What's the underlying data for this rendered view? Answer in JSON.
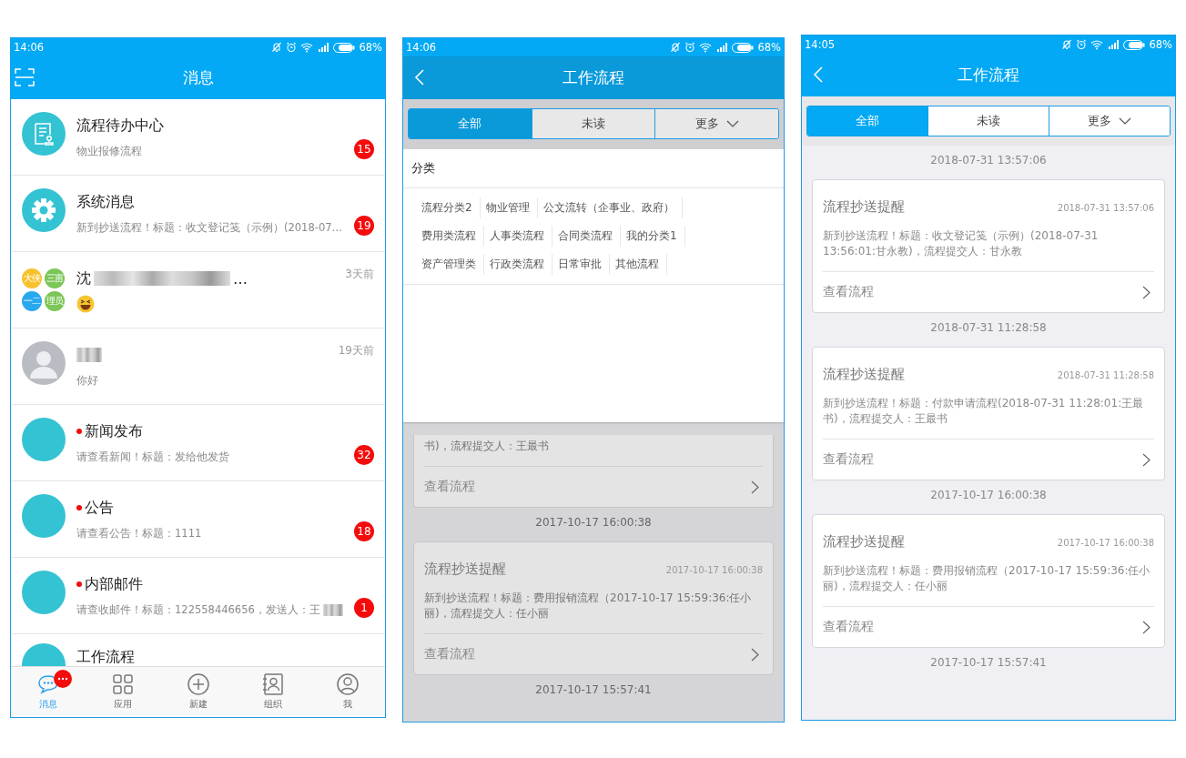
{
  "screens": [
    {
      "kind": "messages",
      "status": {
        "time": "14:06",
        "battery": "68%"
      },
      "title": "消息",
      "conversations": [
        {
          "kind": "document",
          "title": "流程待办中心",
          "subtitle": "物业报修流程",
          "badge": "15",
          "unread_dot": false
        },
        {
          "kind": "gear",
          "title": "系统消息",
          "subtitle": "新到抄送流程！标题：收文登记笺（示例）(2018-07…",
          "badge": "19",
          "unread_dot": false
        },
        {
          "kind": "group",
          "avatar_labels": [
            {
              "text": "大侠",
              "color": "#f8c12e"
            },
            {
              "text": "三亩",
              "color": "#7bc657"
            },
            {
              "text": "一二",
              "color": "#2aa8ee"
            },
            {
              "text": "理员",
              "color": "#7bc657"
            }
          ],
          "title": "沈",
          "title_blurred": true,
          "title_suffix": "…",
          "time": "3天前",
          "subtitle_emoji": true,
          "unread_dot": false
        },
        {
          "kind": "photo",
          "title_blurred": true,
          "time": "19天前",
          "subtitle": "你好",
          "unread_dot": false
        },
        {
          "kind": "plain",
          "title": "新闻发布",
          "subtitle": "请查看新闻！标题：发给他发货",
          "badge": "32",
          "unread_dot": true
        },
        {
          "kind": "plain",
          "title": "公告",
          "subtitle": "请查看公告！标题：1111",
          "badge": "18",
          "unread_dot": true
        },
        {
          "kind": "plain",
          "title": "内部邮件",
          "subtitle": "请查收邮件！标题：122558446656，发送人：王",
          "subtitle_blurred": true,
          "badge": "1",
          "unread_dot": true
        },
        {
          "kind": "plain",
          "title": "工作流程",
          "unread_dot": false,
          "partial": true
        }
      ],
      "tabbar": [
        {
          "kind": "chat",
          "label": "消息",
          "selected": true,
          "more_badge": true
        },
        {
          "kind": "grid",
          "label": "应用",
          "selected": false
        },
        {
          "kind": "plus",
          "label": "新建",
          "selected": false
        },
        {
          "kind": "contacts",
          "label": "组织",
          "selected": false
        },
        {
          "kind": "person",
          "label": "我",
          "selected": false
        }
      ]
    },
    {
      "kind": "workflow",
      "status": {
        "time": "14:06",
        "battery": "68%"
      },
      "title": "工作流程",
      "overlay": true,
      "segments": [
        {
          "label": "全部",
          "selected": true
        },
        {
          "label": "未读",
          "selected": false
        },
        {
          "label": "更多",
          "selected": false,
          "dropdown": true
        }
      ],
      "filter_panel": {
        "heading": "分类",
        "rows": [
          [
            "流程分类2",
            "物业管理",
            "公文流转（企事业、政府）"
          ],
          [
            "费用类流程",
            "人事类流程",
            "合同类流程",
            "我的分类1"
          ],
          [
            "资产管理类",
            "行政类流程",
            "日常审批",
            "其他流程"
          ]
        ]
      },
      "feed": [
        {
          "kind": "card_cut",
          "body": "书)，流程提交人：王最书",
          "action": "查看流程"
        },
        {
          "kind": "date",
          "text": "2017-10-17 16:00:38"
        },
        {
          "kind": "card",
          "title": "流程抄送提醒",
          "time": "2017-10-17 16:00:38",
          "body": "新到抄送流程！标题：费用报销流程（2017-10-17 15:59:36:任小丽)，流程提交人：任小丽",
          "action": "查看流程"
        },
        {
          "kind": "date",
          "text": "2017-10-17 15:57:41"
        }
      ]
    },
    {
      "kind": "workflow",
      "status": {
        "time": "14:05",
        "battery": "68%"
      },
      "title": "工作流程",
      "overlay": false,
      "segments": [
        {
          "label": "全部",
          "selected": true
        },
        {
          "label": "未读",
          "selected": false
        },
        {
          "label": "更多",
          "selected": false,
          "dropdown": true
        }
      ],
      "feed": [
        {
          "kind": "date",
          "text": "2018-07-31 13:57:06"
        },
        {
          "kind": "card",
          "title": "流程抄送提醒",
          "time": "2018-07-31 13:57:06",
          "body": "新到抄送流程！标题：收文登记笺（示例）(2018-07-31 13:56:01:甘永教)，流程提交人：甘永教",
          "action": "查看流程"
        },
        {
          "kind": "date",
          "text": "2018-07-31 11:28:58"
        },
        {
          "kind": "card",
          "title": "流程抄送提醒",
          "time": "2018-07-31 11:28:58",
          "body": "新到抄送流程！标题：付款申请流程(2018-07-31 11:28:01:王最书)，流程提交人：王最书",
          "action": "查看流程"
        },
        {
          "kind": "date",
          "text": "2017-10-17 16:00:38"
        },
        {
          "kind": "card",
          "title": "流程抄送提醒",
          "time": "2017-10-17 16:00:38",
          "body": "新到抄送流程！标题：费用报销流程（2017-10-17 15:59:36:任小丽)，流程提交人：任小丽",
          "action": "查看流程"
        },
        {
          "kind": "date",
          "text": "2017-10-17 15:57:41"
        }
      ]
    }
  ]
}
